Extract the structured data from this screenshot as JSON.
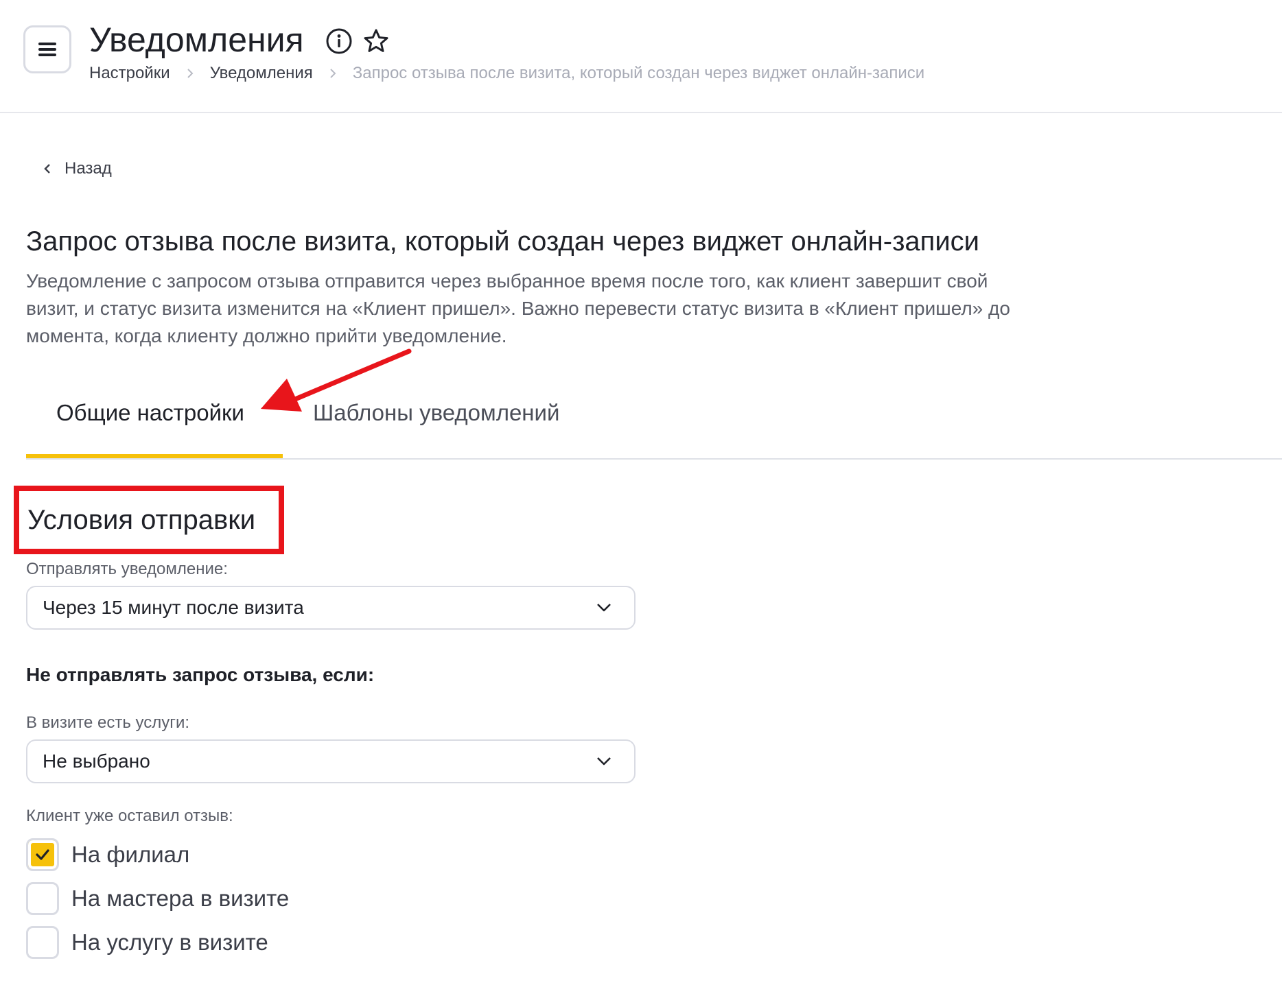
{
  "header": {
    "title": "Уведомления",
    "breadcrumb": [
      "Настройки",
      "Уведомления",
      "Запрос отзыва после визита, который создан через виджет онлайн-записи"
    ]
  },
  "back_label": "Назад",
  "page": {
    "heading": "Запрос отзыва после визита, который создан через виджет онлайн-записи",
    "description": "Уведомление с запросом отзыва отправится через выбранное время после того, как клиент завершит свой визит, и статус визита изменится на «Клиент пришел». Важно перевести статус визита в «Клиент пришел» до момента, когда клиенту должно прийти уведомление."
  },
  "tabs": [
    {
      "label": "Общие настройки",
      "active": true
    },
    {
      "label": "Шаблоны уведомлений",
      "active": false
    }
  ],
  "section": {
    "title": "Условия отправки",
    "send_label": "Отправлять уведомление:",
    "send_value": "Через 15 минут после визита",
    "exclude_heading": "Не отправлять запрос отзыва, если:",
    "services_label": "В визите есть услуги:",
    "services_value": "Не выбрано",
    "review_label": "Клиент уже оставил отзыв:",
    "review_options": [
      {
        "label": "На филиал",
        "checked": true
      },
      {
        "label": "На мастера в визите",
        "checked": false
      },
      {
        "label": "На услугу в визите",
        "checked": false
      }
    ]
  },
  "colors": {
    "accent": "#f6c10a",
    "annotation": "#e8151b",
    "text": "#1f2128",
    "muted": "#a8abb6"
  }
}
